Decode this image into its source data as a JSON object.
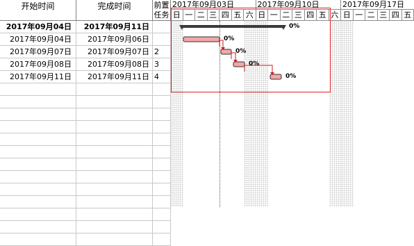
{
  "columns": {
    "start": "开始时间",
    "finish": "完成时间",
    "predecessors": "前置任务"
  },
  "rows": [
    {
      "start": "2017年09月04日",
      "finish": "2017年09月11日",
      "pred": "",
      "summary": true
    },
    {
      "start": "2017年09月04日",
      "finish": "2017年09月06日",
      "pred": ""
    },
    {
      "start": "2017年09月07日",
      "finish": "2017年09月07日",
      "pred": "2"
    },
    {
      "start": "2017年09月08日",
      "finish": "2017年09月08日",
      "pred": "3"
    },
    {
      "start": "2017年09月11日",
      "finish": "2017年09月11日",
      "pred": "4"
    }
  ],
  "empty_rows": 13,
  "timescale": {
    "weeks": [
      "2017年09月03日",
      "2017年09月10日",
      "2017年09月17日"
    ],
    "days": [
      "日",
      "一",
      "二",
      "三",
      "四",
      "五",
      "六",
      "日",
      "一",
      "二",
      "三",
      "四",
      "五",
      "六",
      "日",
      "一",
      "二",
      "三",
      "四",
      "五"
    ]
  },
  "bars": [
    {
      "label": "0%",
      "kind": "summary"
    },
    {
      "label": "0%",
      "kind": "task"
    },
    {
      "label": "0%",
      "kind": "task"
    },
    {
      "label": "0%",
      "kind": "task"
    },
    {
      "label": "0%",
      "kind": "task"
    }
  ],
  "colors": {
    "task_fill": "#f2a7a8",
    "task_border": "#333333",
    "summary_bar": "#3a3a3a",
    "link_arrow": "#d0191e",
    "selection_border": "#e0262b"
  }
}
